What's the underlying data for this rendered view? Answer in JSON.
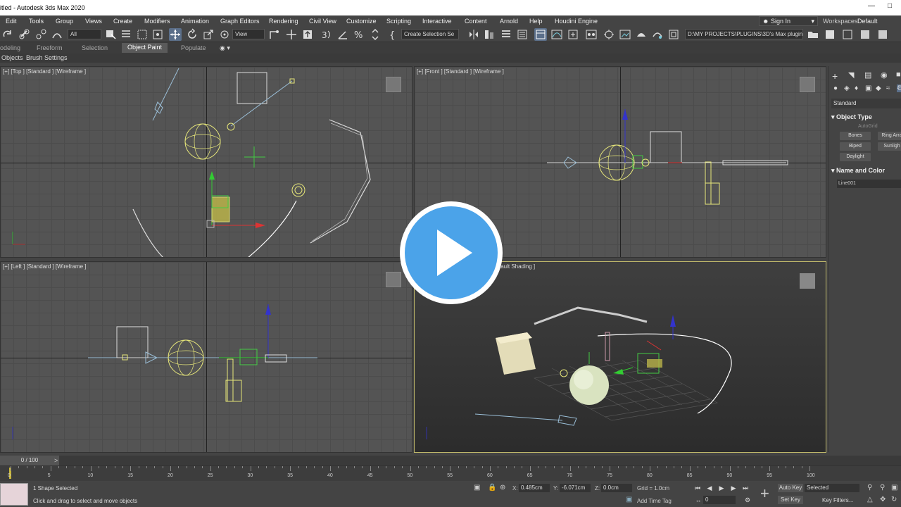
{
  "window": {
    "title": "itled - Autodesk 3ds Max 2020"
  },
  "menu": [
    "Edit",
    "Tools",
    "Group",
    "Views",
    "Create",
    "Modifiers",
    "Animation",
    "Graph Editors",
    "Rendering",
    "Civil View",
    "Customize",
    "Scripting",
    "Interactive",
    "Content",
    "Arnold",
    "Help",
    "Houdini Engine"
  ],
  "account": {
    "signin": "Sign In",
    "workspaces_label": "Workspaces:",
    "workspace": "Default"
  },
  "toolbar": {
    "filter": "All",
    "ref_coord": "View",
    "selection_set": "Create Selection Se",
    "project_path": "D:\\MY PROJECTS\\PLUGINS\\3D's Max plugins"
  },
  "ribbon": {
    "tabs": [
      "odeling",
      "Freeform",
      "Selection",
      "Object Paint",
      "Populate"
    ],
    "active": "Object Paint",
    "sub": [
      "Objects",
      "Brush Settings"
    ]
  },
  "viewports": {
    "top": "[+] [Top ] [Standard ] [Wireframe ]",
    "front": "[+] [Front ] [Standard ] [Wireframe ]",
    "left": "[+] [Left ] [Standard ] [Wireframe ]",
    "persp": "fault Shading ]"
  },
  "command_panel": {
    "category": "Standard",
    "object_type_title": "Object Type",
    "autogrid": "AutoGrid",
    "buttons": [
      "Bones",
      "Ring Arra",
      "Biped",
      "Sunligh",
      "Daylight"
    ],
    "name_color_title": "Name and Color",
    "object_name": "Line001"
  },
  "timeline": {
    "frame_display": "0 / 100",
    "ticks": [
      "0",
      "5",
      "10",
      "15",
      "20",
      "25",
      "30",
      "35",
      "40",
      "45",
      "50",
      "55",
      "60",
      "65",
      "70",
      "75",
      "80",
      "85",
      "90",
      "95",
      "100"
    ]
  },
  "status": {
    "selection": "1 Shape Selected",
    "prompt": "Click and drag to select and move objects",
    "x_label": "X:",
    "x_value": "0.485cm",
    "y_label": "Y:",
    "y_value": "-6.071cm",
    "z_label": "Z:",
    "z_value": "0.0cm",
    "grid": "Grid = 1.0cm",
    "add_time_tag": "Add Time Tag",
    "current_frame": "0",
    "auto_key": "Auto Key",
    "set_key": "Set Key",
    "key_mode": "Selected",
    "key_filters": "Key Filters..."
  },
  "colors": {
    "viewport_bg": "#545454",
    "selected_wire": "#e8e87a",
    "accent_blue": "#4ba3e9"
  }
}
